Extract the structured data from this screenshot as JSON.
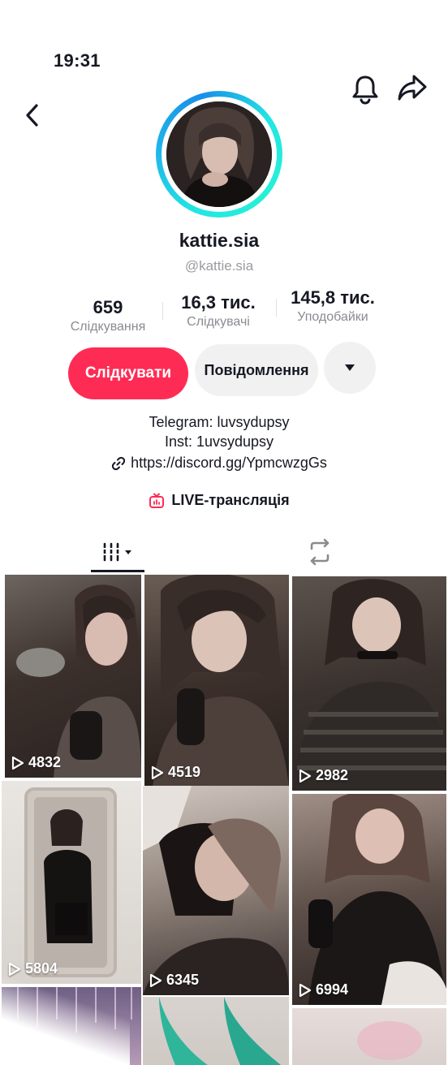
{
  "status_bar": {
    "time": "19:31"
  },
  "header": {
    "back_icon": "chevron-left-icon",
    "bell_icon": "bell-icon",
    "share_icon": "share-icon"
  },
  "profile": {
    "username": "kattie.sia",
    "handle": "@kattie.sia",
    "stats": [
      {
        "value": "659",
        "label": "Слідкування"
      },
      {
        "value": "16,3 тис.",
        "label": "Слідкувачі"
      },
      {
        "value": "145,8 тис.",
        "label": "Уподобайки"
      }
    ],
    "follow_label": "Слідкувати",
    "message_label": "Повідомлення",
    "bio_lines": [
      "Telegram: luvsydupsy",
      "Inst: 1uvsydupsy"
    ],
    "link": "https://discord.gg/YpmcwzgGs",
    "live_label": "LIVE-трансляція"
  },
  "tabs": {
    "grid_icon": "grid-icon",
    "repost_icon": "repost-icon"
  },
  "colors": {
    "accent": "#fe2c55",
    "ring": "#22e7e2",
    "text": "#161823",
    "muted": "#8a8b91"
  },
  "videos": [
    {
      "views": "4832"
    },
    {
      "views": "4519"
    },
    {
      "views": "2982"
    },
    {
      "views": "5804"
    },
    {
      "views": "6345"
    },
    {
      "views": "6994"
    },
    {
      "views": ""
    },
    {
      "views": ""
    },
    {
      "views": ""
    }
  ]
}
